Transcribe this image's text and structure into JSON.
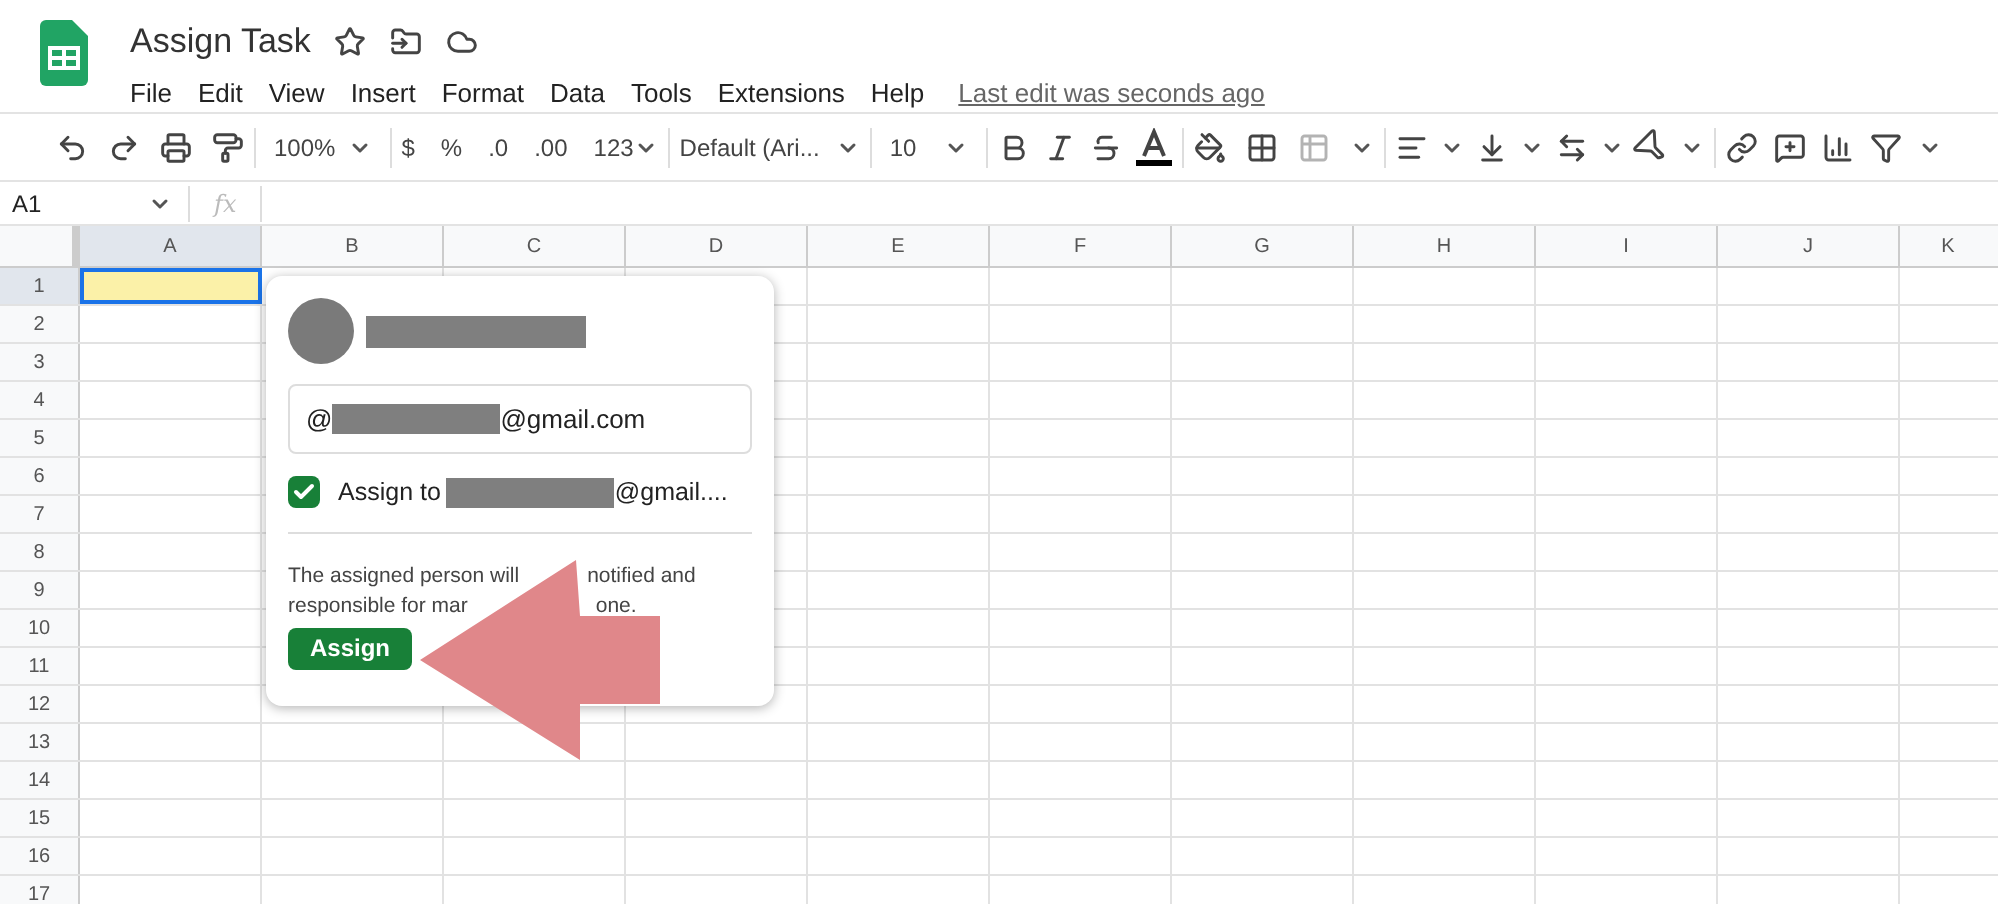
{
  "app": {
    "title": "Assign Task",
    "menu": [
      "File",
      "Edit",
      "View",
      "Insert",
      "Format",
      "Data",
      "Tools",
      "Extensions",
      "Help"
    ],
    "last_edit": "Last edit was seconds ago"
  },
  "toolbar": {
    "zoom": "100%",
    "currency": "$",
    "percent": "%",
    "decrease_decimals": ".0",
    "increase_decimals": ".00",
    "number_format": "123",
    "font": "Default (Ari...",
    "font_size": "10"
  },
  "formula_bar": {
    "name_box": "A1",
    "fx": "fx"
  },
  "grid": {
    "columns": [
      {
        "label": "A",
        "selected": true
      },
      {
        "label": "B",
        "selected": false
      },
      {
        "label": "C",
        "selected": false
      },
      {
        "label": "D",
        "selected": false
      },
      {
        "label": "E",
        "selected": false
      },
      {
        "label": "F",
        "selected": false
      },
      {
        "label": "G",
        "selected": false
      },
      {
        "label": "H",
        "selected": false
      },
      {
        "label": "I",
        "selected": false
      },
      {
        "label": "J",
        "selected": false
      },
      {
        "label": "K",
        "selected": false
      }
    ],
    "rows": [
      {
        "label": "1",
        "selected": true
      },
      {
        "label": "2",
        "selected": false
      },
      {
        "label": "3",
        "selected": false
      },
      {
        "label": "4",
        "selected": false
      },
      {
        "label": "5",
        "selected": false
      },
      {
        "label": "6",
        "selected": false
      },
      {
        "label": "7",
        "selected": false
      },
      {
        "label": "8",
        "selected": false
      },
      {
        "label": "9",
        "selected": false
      },
      {
        "label": "10",
        "selected": false
      },
      {
        "label": "11",
        "selected": false
      },
      {
        "label": "12",
        "selected": false
      },
      {
        "label": "13",
        "selected": false
      },
      {
        "label": "14",
        "selected": false
      },
      {
        "label": "15",
        "selected": false
      },
      {
        "label": "16",
        "selected": false
      },
      {
        "label": "17",
        "selected": false
      }
    ]
  },
  "popup": {
    "email_prefix": "@",
    "email_suffix": "@gmail.com",
    "assign_checked": true,
    "assign_label": "Assign to",
    "assign_suffix": "@gmail....",
    "note_line_1": [
      "The assigned person will",
      "notified and"
    ],
    "note_line_2": [
      "responsible for mar",
      "one."
    ],
    "button": "Assign"
  }
}
